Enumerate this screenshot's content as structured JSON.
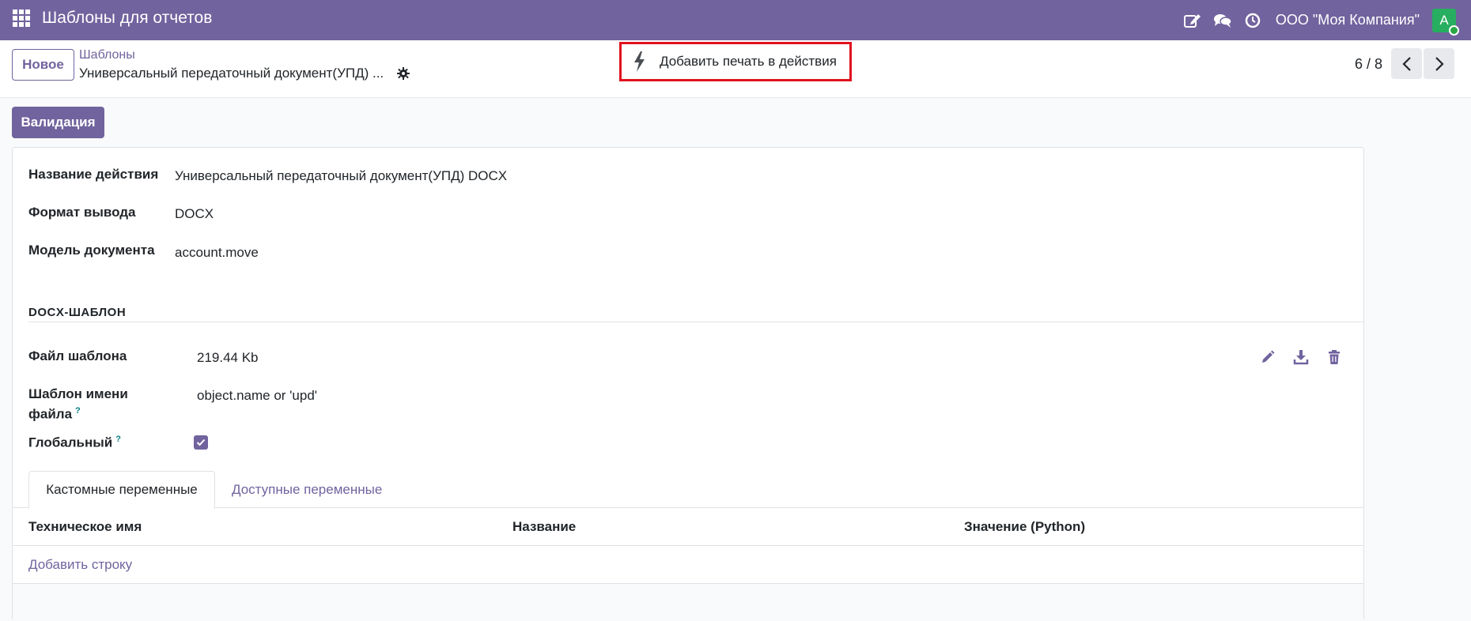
{
  "navbar": {
    "app_title": "Шаблоны для отчетов",
    "company": "ООО \"Моя Компания\"",
    "avatar_letter": "A",
    "icons": [
      "apps-grid-icon",
      "edit-icon",
      "chat-icon",
      "clock-icon"
    ]
  },
  "control_panel": {
    "new_button": "Новое",
    "breadcrumb": "Шаблоны",
    "record_name": "Универсальный передаточный документ(УПД) ...",
    "action_button": "Добавить печать в действия",
    "pager": "6 / 8"
  },
  "statusbar": {
    "validate_button": "Валидация"
  },
  "form": {
    "action_name_label": "Название действия",
    "action_name_value": "Универсальный передаточный документ(УПД) DOCX",
    "output_format_label": "Формат вывода",
    "output_format_value": "DOCX",
    "model_label": "Модель документа",
    "model_value": "account.move",
    "section_title": "DOCX-ШАБЛОН",
    "template_file_label": "Файл шаблона",
    "template_file_value": "219.44 Kb",
    "filename_template_label_1": "Шаблон имени",
    "filename_template_label_2": "файла",
    "filename_template_value": "object.name or 'upd'",
    "global_label": "Глобальный",
    "global_checked": true,
    "help_mark": "?"
  },
  "tabs": {
    "custom_vars": "Кастомные переменные",
    "available_vars": "Доступные переменные"
  },
  "table": {
    "columns": [
      "Техническое имя",
      "Название",
      "Значение (Python)"
    ],
    "add_line": "Добавить строку"
  },
  "colors": {
    "brand": "#71639e",
    "highlight": "#e0111e",
    "avatar": "#27ae60"
  }
}
